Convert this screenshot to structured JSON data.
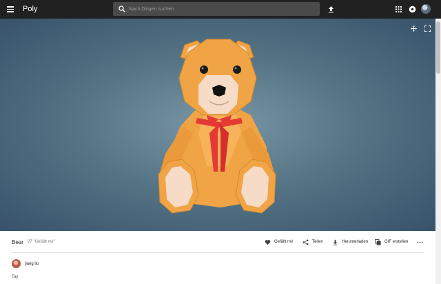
{
  "topbar": {
    "logo": "Poly",
    "search_placeholder": "Nach Dingen suchen",
    "icons": [
      "menu-icon",
      "search-icon",
      "upload-icon",
      "apps-grid-icon",
      "notifications-icon",
      "avatar"
    ]
  },
  "viewer": {
    "icons": [
      "move-icon",
      "fullscreen-icon"
    ]
  },
  "model": {
    "title": "Bear",
    "likes": "27 \"Gefällt mir\""
  },
  "actions": {
    "like": "Gefällt mir",
    "share": "Teilen",
    "download": "Herunterladen",
    "gif": "GIF erstellen"
  },
  "author": {
    "name": "jiang liu"
  },
  "description": "Toy",
  "colors": {
    "topbar": "#212121",
    "bear_fur": "#f0a445",
    "ribbon": "#e53935"
  }
}
